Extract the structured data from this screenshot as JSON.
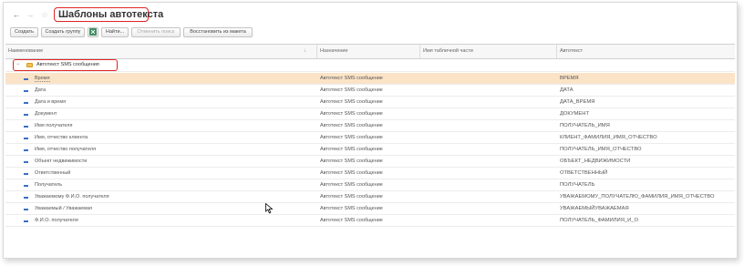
{
  "window": {
    "title": "Шаблоны автотекста",
    "back_label": "←",
    "forward_label": "→",
    "favorite_label": "☆"
  },
  "toolbar": {
    "create": "Создать",
    "create_group": "Создать группу",
    "excel_icon": "excel-icon",
    "find": "Найти...",
    "cancel_search": "Отменить поиск",
    "restore_layout": "Восстановить из макета"
  },
  "table": {
    "columns": [
      "Наименование",
      "Назначение",
      "Имя табличной части",
      "Автотекст"
    ],
    "group": {
      "expand_glyph": "−",
      "label": "Автотекст SMS сообщения"
    },
    "rows": [
      {
        "name": "Время",
        "purpose": "Автотекст SMS сообщение",
        "table_part": "",
        "autotext": "ВРЕМЯ",
        "selected": true
      },
      {
        "name": "Дата",
        "purpose": "Автотекст SMS сообщение",
        "table_part": "",
        "autotext": "ДАТА"
      },
      {
        "name": "Дата и время",
        "purpose": "Автотекст SMS сообщение",
        "table_part": "",
        "autotext": "ДАТА_ВРЕМЯ"
      },
      {
        "name": "Документ",
        "purpose": "Автотекст SMS сообщение",
        "table_part": "",
        "autotext": "ДОКУМЕНТ"
      },
      {
        "name": "Имя получателя",
        "purpose": "Автотекст SMS сообщение",
        "table_part": "",
        "autotext": "ПОЛУЧАТЕЛЬ_ИМЯ"
      },
      {
        "name": "Имя, отчество клиента",
        "purpose": "Автотекст SMS сообщение",
        "table_part": "",
        "autotext": "КЛИЕНТ_ФАМИЛИЯ_ИМЯ_ОТЧЕСТВО"
      },
      {
        "name": "Имя, отчество получателя",
        "purpose": "Автотекст SMS сообщение",
        "table_part": "",
        "autotext": "ПОЛУЧАТЕЛЬ_ИМЯ_ОТЧЕСТВО"
      },
      {
        "name": "Объект недвижимости",
        "purpose": "Автотекст SMS сообщение",
        "table_part": "",
        "autotext": "ОБЪЕКТ_НЕДВИЖИМОСТИ"
      },
      {
        "name": "Ответственный",
        "purpose": "Автотекст SMS сообщение",
        "table_part": "",
        "autotext": "ОТВЕТСТВЕННЫЙ"
      },
      {
        "name": "Получатель",
        "purpose": "Автотекст SMS сообщение",
        "table_part": "",
        "autotext": "ПОЛУЧАТЕЛЬ"
      },
      {
        "name": "Уважаемому Ф.И.О. получателя",
        "purpose": "Автотекст SMS сообщение",
        "table_part": "",
        "autotext": "УВАЖАЕМОМУ_ПОЛУЧАТЕЛЮ_ФАМИЛИЯ_ИМЯ_ОТЧЕСТВО"
      },
      {
        "name": "Уважаемый / Уважаемая",
        "purpose": "Автотекст SMS сообщение",
        "table_part": "",
        "autotext": "УВАЖАЕМЫЙУВАЖАЕМАЯ"
      },
      {
        "name": "Ф.И.О. получателя",
        "purpose": "Автотекст SMS сообщение",
        "table_part": "",
        "autotext": "ПОЛУЧАТЕЛЬ_ФАМИЛИЯ_И_О"
      }
    ]
  },
  "colors": {
    "selected_row": "#fbe3c7",
    "highlight_border": "#e02424",
    "item_icon": "#3a6fc4",
    "folder_icon": "#f2c14e"
  }
}
